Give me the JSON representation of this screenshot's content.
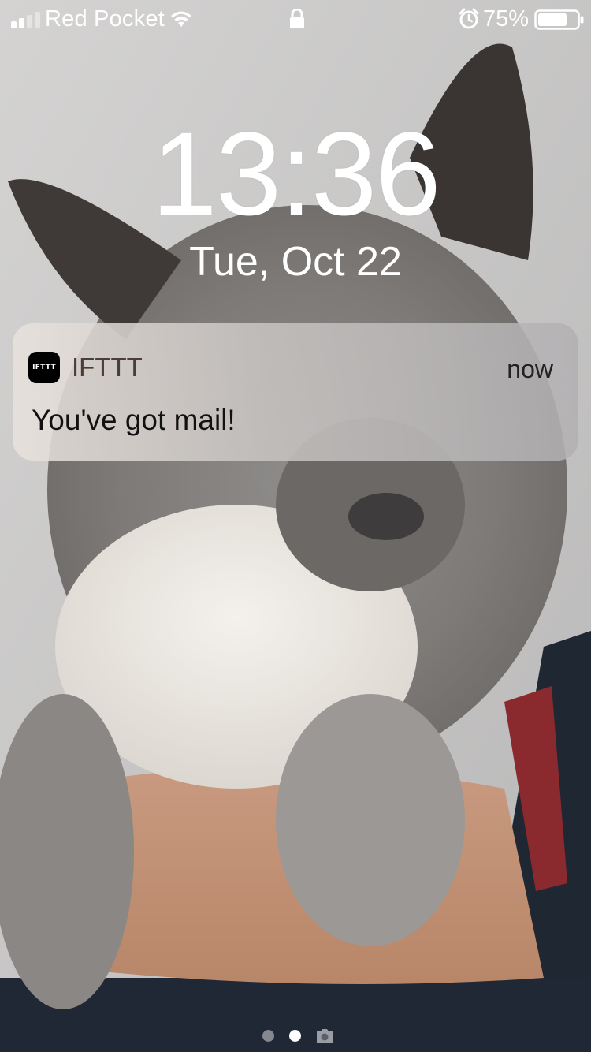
{
  "status_bar": {
    "carrier": "Red Pocket",
    "battery_percent": "75%",
    "battery_level": 0.75,
    "signal_bars_filled": 2,
    "signal_bars_total": 4,
    "icons": [
      "signal-icon",
      "wifi-icon",
      "lock-icon",
      "alarm-icon",
      "battery-icon"
    ]
  },
  "lock_screen": {
    "time": "13:36",
    "date": "Tue, Oct 22"
  },
  "notification": {
    "app_icon_text": "IFTTT",
    "app_name": "IFTTT",
    "time": "now",
    "message": "You've got mail!"
  },
  "page_indicator": {
    "pages": 2,
    "active_page": 2,
    "trailing_icon": "camera-icon"
  },
  "colors": {
    "app_name": "#4b3e34",
    "message_text": "#111111",
    "status_text": "#ffffff"
  }
}
